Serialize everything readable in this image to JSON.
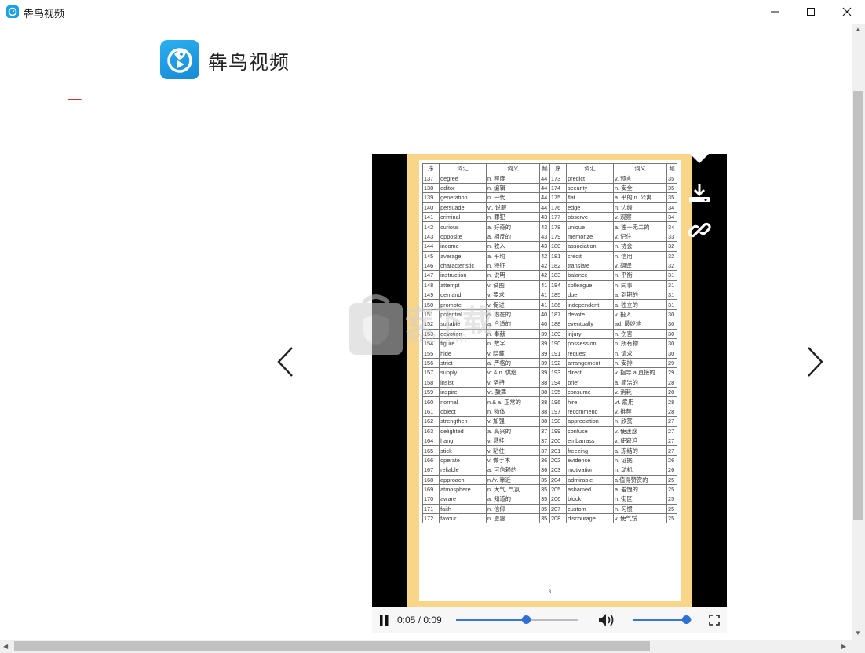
{
  "window": {
    "title": "犇鸟视频"
  },
  "header": {
    "brand_name": "犇鸟视频"
  },
  "player": {
    "time": "0:05 / 0:09",
    "progress": 0.57,
    "volume": 0.9,
    "sheet": {
      "headers": [
        "序",
        "词汇",
        "词义",
        "频",
        "序",
        "词汇",
        "词义",
        "频"
      ],
      "rows": [
        [
          "137",
          "degree",
          "n. 程度",
          "44",
          "173",
          "predict",
          "v. 预言",
          "35"
        ],
        [
          "138",
          "editor",
          "n. 编辑",
          "44",
          "174",
          "security",
          "n. 安全",
          "35"
        ],
        [
          "139",
          "generation",
          "n. 一代",
          "44",
          "175",
          "flat",
          "a. 平的 n. 公寓",
          "35"
        ],
        [
          "140",
          "persuade",
          "vt. 说服",
          "44",
          "176",
          "edge",
          "n. 边缘",
          "34"
        ],
        [
          "141",
          "criminal",
          "n. 罪犯",
          "43",
          "177",
          "observe",
          "v. 观察",
          "34"
        ],
        [
          "142",
          "curious",
          "a. 好奇的",
          "43",
          "178",
          "unique",
          "a. 独一无二的",
          "34"
        ],
        [
          "143",
          "opposite",
          "a. 相反的",
          "43",
          "179",
          "memorize",
          "v. 记住",
          "33"
        ],
        [
          "144",
          "income",
          "n. 收入",
          "43",
          "180",
          "association",
          "n. 协会",
          "32"
        ],
        [
          "145",
          "average",
          "a. 平均",
          "42",
          "181",
          "credit",
          "n. 信用",
          "32"
        ],
        [
          "146",
          "characteristic",
          "n. 特征",
          "42",
          "182",
          "translate",
          "v. 翻译",
          "32"
        ],
        [
          "147",
          "instruction",
          "n. 说明",
          "42",
          "183",
          "balance",
          "n. 平衡",
          "31"
        ],
        [
          "148",
          "attempt",
          "v. 试图",
          "41",
          "184",
          "colleague",
          "n. 同事",
          "31"
        ],
        [
          "149",
          "demand",
          "v. 要求",
          "41",
          "185",
          "due",
          "a. 到期的",
          "31"
        ],
        [
          "150",
          "promote",
          "v. 促进",
          "41",
          "186",
          "independent",
          "a. 独立的",
          "31"
        ],
        [
          "151",
          "potential",
          "a. 潜在的",
          "40",
          "187",
          "devote",
          "v. 投入",
          "30"
        ],
        [
          "152",
          "suitable",
          "a. 合适的",
          "40",
          "188",
          "eventually",
          "ad. 最终地",
          "30"
        ],
        [
          "153",
          "devotion",
          "n. 奉献",
          "39",
          "189",
          "injury",
          "n. 伤害",
          "30"
        ],
        [
          "154",
          "figure",
          "n. 数字",
          "39",
          "190",
          "possession",
          "n. 所有物",
          "30"
        ],
        [
          "155",
          "hide",
          "v. 隐藏",
          "39",
          "191",
          "request",
          "n. 请求",
          "30"
        ],
        [
          "156",
          "strict",
          "a. 严格的",
          "39",
          "192",
          "arrangement",
          "n. 安排",
          "29"
        ],
        [
          "157",
          "supply",
          "vt.& n. 供给",
          "39",
          "193",
          "direct",
          "v. 指导 a.直接的",
          "29"
        ],
        [
          "158",
          "insist",
          "v. 坚持",
          "38",
          "194",
          "brief",
          "a. 简洁的",
          "28"
        ],
        [
          "159",
          "inspire",
          "vt. 鼓舞",
          "38",
          "195",
          "consume",
          "v. 消耗",
          "28"
        ],
        [
          "160",
          "normal",
          "n.& a. 正常的",
          "38",
          "196",
          "hire",
          "vt. 雇用",
          "28"
        ],
        [
          "161",
          "object",
          "n. 物体",
          "38",
          "197",
          "recommend",
          "v. 推荐",
          "28"
        ],
        [
          "162",
          "strengthen",
          "v. 加强",
          "38",
          "198",
          "appreciation",
          "n. 欣赏",
          "27"
        ],
        [
          "163",
          "delighted",
          "a. 高兴的",
          "37",
          "199",
          "confuse",
          "v. 使迷惑",
          "27"
        ],
        [
          "164",
          "hang",
          "v. 悬挂",
          "37",
          "200",
          "embarrass",
          "v. 使窘迫",
          "27"
        ],
        [
          "165",
          "stick",
          "v. 粘住",
          "37",
          "201",
          "freezing",
          "a. 冻结的",
          "27"
        ],
        [
          "166",
          "operate",
          "v. 做手术",
          "36",
          "202",
          "evidence",
          "n. 证据",
          "26"
        ],
        [
          "167",
          "reliable",
          "a. 可信赖的",
          "36",
          "203",
          "motivation",
          "n. 动机",
          "26"
        ],
        [
          "168",
          "approach",
          "n./v. 靠近",
          "35",
          "204",
          "admirable",
          "a.值得赞赏的",
          "25"
        ],
        [
          "169",
          "atmosphere",
          "n. 大气, 气氛",
          "35",
          "205",
          "ashamed",
          "a. 羞愧的",
          "25"
        ],
        [
          "170",
          "aware",
          "a. 知道的",
          "35",
          "206",
          "block",
          "n. 街区",
          "25"
        ],
        [
          "171",
          "faith",
          "n. 信仰",
          "35",
          "207",
          "custom",
          "n. 习惯",
          "25"
        ],
        [
          "172",
          "favour",
          "n. 恩惠",
          "35",
          "208",
          "discourage",
          "v. 使气馁",
          "25"
        ]
      ],
      "page_number": "3"
    }
  },
  "watermark": {
    "text": "安下载",
    "sub": "anxz.com"
  },
  "icons": {
    "app": "bird-app-icon",
    "minimize": "minimize-icon",
    "maximize": "maximize-icon",
    "close": "close-icon",
    "download": "download-icon",
    "link": "link-icon",
    "prev": "chevron-left-icon",
    "next": "chevron-right-icon",
    "pause": "pause-icon",
    "volume": "volume-icon",
    "fullscreen": "fullscreen-icon"
  },
  "colors": {
    "accent": "#2f6fd6",
    "brand": "#1aa0e6",
    "frame": "#f9d58a"
  }
}
